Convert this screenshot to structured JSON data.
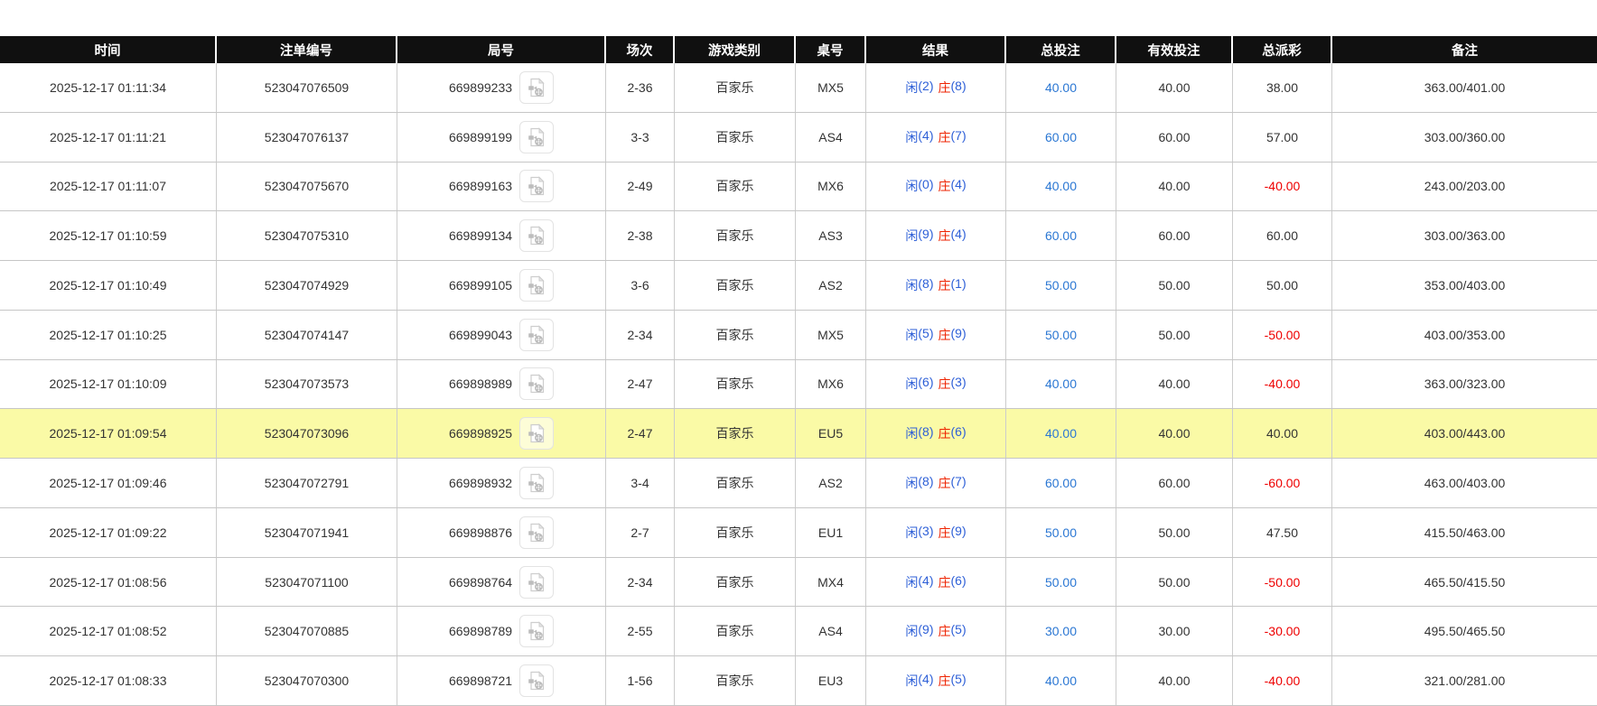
{
  "colors": {
    "header_bg": "#101010",
    "header_text": "#ffffff",
    "row_border": "#c6c6c6",
    "cell_divider": "#cccccc",
    "text": "#333333",
    "link_blue": "#2b77d3",
    "result_blue": "#2d5fd7",
    "result_red": "#ee2200",
    "negative_red": "#ee0000",
    "highlight_row_bg": "#fafaa6",
    "page_bg": "#ffffff"
  },
  "icons": {
    "round_replay": "video-replay-icon"
  },
  "table": {
    "columns": [
      {
        "key": "time",
        "label": "时间"
      },
      {
        "key": "bet_no",
        "label": "注单编号"
      },
      {
        "key": "round_no",
        "label": "局号"
      },
      {
        "key": "session",
        "label": "场次"
      },
      {
        "key": "game_type",
        "label": "游戏类别"
      },
      {
        "key": "table_no",
        "label": "桌号"
      },
      {
        "key": "result",
        "label": "结果"
      },
      {
        "key": "total_bet",
        "label": "总投注"
      },
      {
        "key": "valid_bet",
        "label": "有效投注"
      },
      {
        "key": "total_payout",
        "label": "总派彩"
      },
      {
        "key": "remark",
        "label": "备注"
      }
    ],
    "rows": [
      {
        "time": "2025-12-17 01:11:34",
        "bet_no": "523047076509",
        "round_no": "669899233",
        "session": "2-36",
        "game_type": "百家乐",
        "table_no": "MX5",
        "result": {
          "player_label": "闲",
          "player_score": "(2)",
          "banker_label": "庄",
          "banker_score": "(8)"
        },
        "total_bet": "40.00",
        "valid_bet": "40.00",
        "total_payout": "38.00",
        "payout_negative": false,
        "remark": "363.00/401.00",
        "highlighted": false
      },
      {
        "time": "2025-12-17 01:11:21",
        "bet_no": "523047076137",
        "round_no": "669899199",
        "session": "3-3",
        "game_type": "百家乐",
        "table_no": "AS4",
        "result": {
          "player_label": "闲",
          "player_score": "(4)",
          "banker_label": "庄",
          "banker_score": "(7)"
        },
        "total_bet": "60.00",
        "valid_bet": "60.00",
        "total_payout": "57.00",
        "payout_negative": false,
        "remark": "303.00/360.00",
        "highlighted": false
      },
      {
        "time": "2025-12-17 01:11:07",
        "bet_no": "523047075670",
        "round_no": "669899163",
        "session": "2-49",
        "game_type": "百家乐",
        "table_no": "MX6",
        "result": {
          "player_label": "闲",
          "player_score": "(0)",
          "banker_label": "庄",
          "banker_score": "(4)"
        },
        "total_bet": "40.00",
        "valid_bet": "40.00",
        "total_payout": "-40.00",
        "payout_negative": true,
        "remark": "243.00/203.00",
        "highlighted": false
      },
      {
        "time": "2025-12-17 01:10:59",
        "bet_no": "523047075310",
        "round_no": "669899134",
        "session": "2-38",
        "game_type": "百家乐",
        "table_no": "AS3",
        "result": {
          "player_label": "闲",
          "player_score": "(9)",
          "banker_label": "庄",
          "banker_score": "(4)"
        },
        "total_bet": "60.00",
        "valid_bet": "60.00",
        "total_payout": "60.00",
        "payout_negative": false,
        "remark": "303.00/363.00",
        "highlighted": false
      },
      {
        "time": "2025-12-17 01:10:49",
        "bet_no": "523047074929",
        "round_no": "669899105",
        "session": "3-6",
        "game_type": "百家乐",
        "table_no": "AS2",
        "result": {
          "player_label": "闲",
          "player_score": "(8)",
          "banker_label": "庄",
          "banker_score": "(1)"
        },
        "total_bet": "50.00",
        "valid_bet": "50.00",
        "total_payout": "50.00",
        "payout_negative": false,
        "remark": "353.00/403.00",
        "highlighted": false
      },
      {
        "time": "2025-12-17 01:10:25",
        "bet_no": "523047074147",
        "round_no": "669899043",
        "session": "2-34",
        "game_type": "百家乐",
        "table_no": "MX5",
        "result": {
          "player_label": "闲",
          "player_score": "(5)",
          "banker_label": "庄",
          "banker_score": "(9)"
        },
        "total_bet": "50.00",
        "valid_bet": "50.00",
        "total_payout": "-50.00",
        "payout_negative": true,
        "remark": "403.00/353.00",
        "highlighted": false
      },
      {
        "time": "2025-12-17 01:10:09",
        "bet_no": "523047073573",
        "round_no": "669898989",
        "session": "2-47",
        "game_type": "百家乐",
        "table_no": "MX6",
        "result": {
          "player_label": "闲",
          "player_score": "(6)",
          "banker_label": "庄",
          "banker_score": "(3)"
        },
        "total_bet": "40.00",
        "valid_bet": "40.00",
        "total_payout": "-40.00",
        "payout_negative": true,
        "remark": "363.00/323.00",
        "highlighted": false
      },
      {
        "time": "2025-12-17 01:09:54",
        "bet_no": "523047073096",
        "round_no": "669898925",
        "session": "2-47",
        "game_type": "百家乐",
        "table_no": "EU5",
        "result": {
          "player_label": "闲",
          "player_score": "(8)",
          "banker_label": "庄",
          "banker_score": "(6)"
        },
        "total_bet": "40.00",
        "valid_bet": "40.00",
        "total_payout": "40.00",
        "payout_negative": false,
        "remark": "403.00/443.00",
        "highlighted": true
      },
      {
        "time": "2025-12-17 01:09:46",
        "bet_no": "523047072791",
        "round_no": "669898932",
        "session": "3-4",
        "game_type": "百家乐",
        "table_no": "AS2",
        "result": {
          "player_label": "闲",
          "player_score": "(8)",
          "banker_label": "庄",
          "banker_score": "(7)"
        },
        "total_bet": "60.00",
        "valid_bet": "60.00",
        "total_payout": "-60.00",
        "payout_negative": true,
        "remark": "463.00/403.00",
        "highlighted": false
      },
      {
        "time": "2025-12-17 01:09:22",
        "bet_no": "523047071941",
        "round_no": "669898876",
        "session": "2-7",
        "game_type": "百家乐",
        "table_no": "EU1",
        "result": {
          "player_label": "闲",
          "player_score": "(3)",
          "banker_label": "庄",
          "banker_score": "(9)"
        },
        "total_bet": "50.00",
        "valid_bet": "50.00",
        "total_payout": "47.50",
        "payout_negative": false,
        "remark": "415.50/463.00",
        "highlighted": false
      },
      {
        "time": "2025-12-17 01:08:56",
        "bet_no": "523047071100",
        "round_no": "669898764",
        "session": "2-34",
        "game_type": "百家乐",
        "table_no": "MX4",
        "result": {
          "player_label": "闲",
          "player_score": "(4)",
          "banker_label": "庄",
          "banker_score": "(6)"
        },
        "total_bet": "50.00",
        "valid_bet": "50.00",
        "total_payout": "-50.00",
        "payout_negative": true,
        "remark": "465.50/415.50",
        "highlighted": false
      },
      {
        "time": "2025-12-17 01:08:52",
        "bet_no": "523047070885",
        "round_no": "669898789",
        "session": "2-55",
        "game_type": "百家乐",
        "table_no": "AS4",
        "result": {
          "player_label": "闲",
          "player_score": "(9)",
          "banker_label": "庄",
          "banker_score": "(5)"
        },
        "total_bet": "30.00",
        "valid_bet": "30.00",
        "total_payout": "-30.00",
        "payout_negative": true,
        "remark": "495.50/465.50",
        "highlighted": false
      },
      {
        "time": "2025-12-17 01:08:33",
        "bet_no": "523047070300",
        "round_no": "669898721",
        "session": "1-56",
        "game_type": "百家乐",
        "table_no": "EU3",
        "result": {
          "player_label": "闲",
          "player_score": "(4)",
          "banker_label": "庄",
          "banker_score": "(5)"
        },
        "total_bet": "40.00",
        "valid_bet": "40.00",
        "total_payout": "-40.00",
        "payout_negative": true,
        "remark": "321.00/281.00",
        "highlighted": false
      }
    ]
  }
}
